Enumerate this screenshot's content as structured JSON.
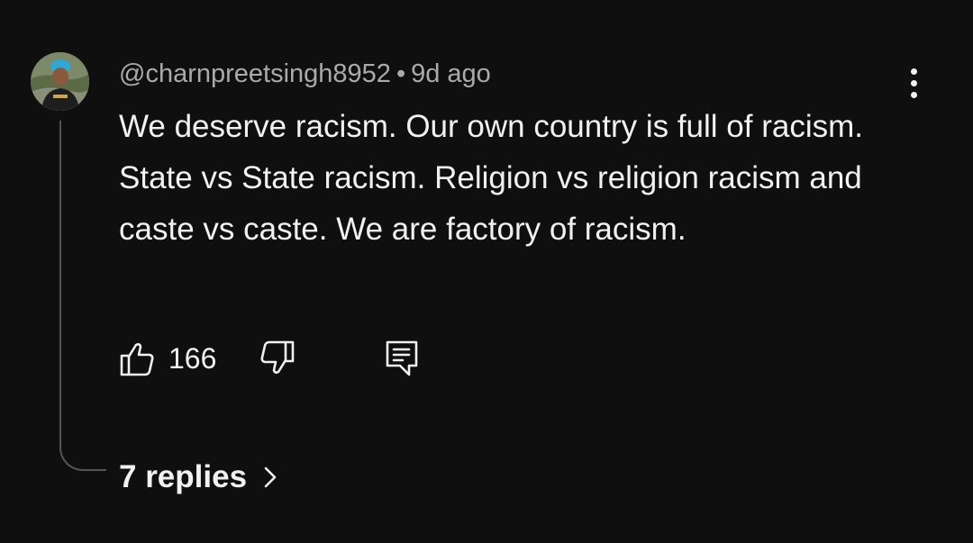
{
  "comment": {
    "author": "@charnpreetsingh8952",
    "separator": "•",
    "time": "9d ago",
    "text": "We deserve racism. Our own country is full of racism. State vs State racism. Religion vs religion racism and caste vs caste. We are factory of racism.",
    "like_count": "166",
    "replies_label": "7 replies"
  },
  "icons": {
    "avatar": "avatar",
    "menu": "more-vert-icon",
    "like": "thumb-up-icon",
    "dislike": "thumb-down-icon",
    "reply": "reply-comment-icon",
    "chevron": "chevron-right-icon"
  },
  "colors": {
    "background": "#0f0f0f",
    "primary_text": "#f1f1f1",
    "secondary_text": "#aaaaaa",
    "thread_line": "#555555"
  }
}
